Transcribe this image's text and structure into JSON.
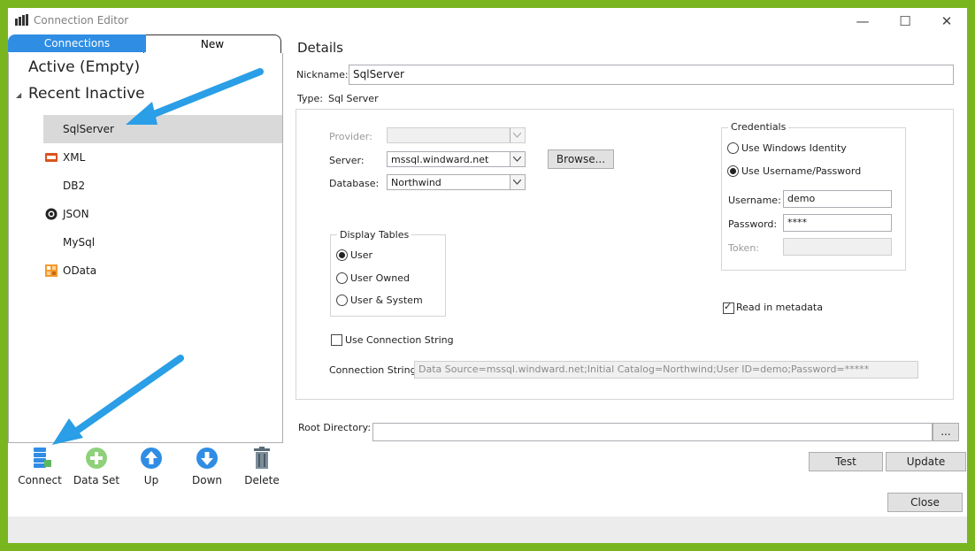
{
  "window": {
    "title": "Connection Editor",
    "minimize": "—",
    "maximize": "☐",
    "close": "✕"
  },
  "tabs": {
    "active": "Connections",
    "new": "New"
  },
  "tree": {
    "active_header": "Active (Empty)",
    "inactive_header": "Recent Inactive",
    "items": [
      {
        "label": "SqlServer",
        "icon": "none",
        "selected": true
      },
      {
        "label": "XML",
        "icon": "xml-icon"
      },
      {
        "label": "DB2",
        "icon": "none"
      },
      {
        "label": "JSON",
        "icon": "json-icon"
      },
      {
        "label": "MySql",
        "icon": "none"
      },
      {
        "label": "OData",
        "icon": "odata-icon"
      }
    ]
  },
  "toolbar": {
    "connect": "Connect",
    "dataset": "Data Set",
    "up": "Up",
    "down": "Down",
    "delete": "Delete"
  },
  "details": {
    "heading": "Details",
    "nickname_label": "Nickname:",
    "nickname_value": "SqlServer",
    "type_label": "Type:",
    "type_value": "Sql Server",
    "provider_label": "Provider:",
    "provider_value": "",
    "server_label": "Server:",
    "server_value": "mssql.windward.net",
    "browse_label": "Browse...",
    "database_label": "Database:",
    "database_value": "Northwind",
    "credentials": {
      "title": "Credentials",
      "windows_identity": "Use Windows Identity",
      "username_password": "Use Username/Password",
      "selected": "username_password",
      "username_label": "Username:",
      "username_value": "demo",
      "password_label": "Password:",
      "password_value": "****",
      "token_label": "Token:",
      "token_value": ""
    },
    "display_tables": {
      "title": "Display Tables",
      "options": [
        "User",
        "User Owned",
        "User & System"
      ],
      "selected": "User"
    },
    "read_metadata_label": "Read in metadata",
    "read_metadata_checked": true,
    "use_conn_string_label": "Use Connection String",
    "use_conn_string_checked": false,
    "conn_string_label": "Connection String:",
    "conn_string_value": "Data Source=mssql.windward.net;Initial Catalog=Northwind;User ID=demo;Password=*****"
  },
  "root_directory": {
    "label": "Root Directory:",
    "value": "",
    "browse": "..."
  },
  "buttons": {
    "test": "Test",
    "update": "Update",
    "close": "Close"
  },
  "colors": {
    "frame": "#79b51f",
    "tab_active": "#2f8de4",
    "arrow": "#2a9ee6",
    "selection": "#d9d9d9"
  }
}
